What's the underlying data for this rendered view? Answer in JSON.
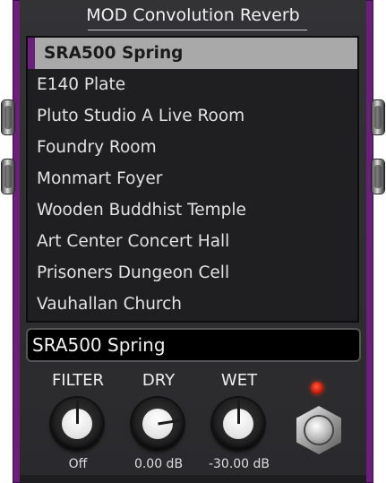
{
  "plugin": {
    "title": "MOD Convolution Reverb",
    "colors": {
      "chassis": "#6a1f7a",
      "faceplate": "#303033",
      "selected_row": "#a9a9a9",
      "led": "#d62a10"
    }
  },
  "ir_list": {
    "items": [
      {
        "label": "SRA500 Spring"
      },
      {
        "label": "E140 Plate"
      },
      {
        "label": "Pluto Studio A Live Room"
      },
      {
        "label": "Foundry Room"
      },
      {
        "label": "Monmart Foyer"
      },
      {
        "label": "Wooden Buddhist Temple"
      },
      {
        "label": "Art Center Concert Hall"
      },
      {
        "label": "Prisoners Dungeon Cell"
      },
      {
        "label": "Vauhallan Church"
      }
    ],
    "selected_index": 0
  },
  "current_ir": {
    "name": "SRA500 Spring"
  },
  "knobs": {
    "filter": {
      "label": "FILTER",
      "value": "Off",
      "level": 0.5
    },
    "dry": {
      "label": "DRY",
      "value": "0.00 dB",
      "level": 0.8
    },
    "wet": {
      "label": "WET",
      "value": "-30.00 dB",
      "level": 0.5
    }
  },
  "bypass": {
    "led_icon": "led-indicator-icon",
    "switch_icon": "footswitch-icon",
    "led_on": true
  }
}
